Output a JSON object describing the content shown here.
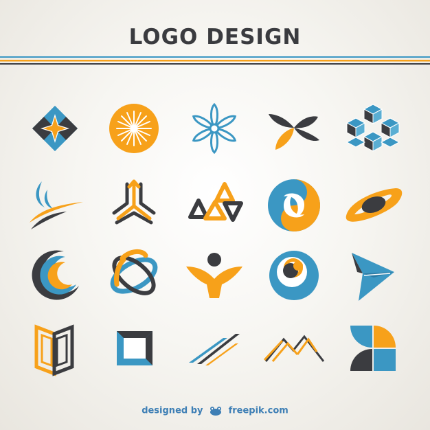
{
  "header": {
    "title": "LOGO DESIGN"
  },
  "footer": {
    "prefix": "designed by",
    "brand": "freepik.com"
  },
  "colors": {
    "orange": "#f7a11a",
    "blue": "#3b97c3",
    "dark": "#3b3c40"
  },
  "logos": [
    {
      "name": "diamond-star-logo-icon"
    },
    {
      "name": "orange-sun-starburst-logo-icon"
    },
    {
      "name": "blue-flower-outline-logo-icon"
    },
    {
      "name": "leaf-propeller-logo-icon"
    },
    {
      "name": "isometric-cubes-logo-icon"
    },
    {
      "name": "swoosh-lines-logo-icon"
    },
    {
      "name": "tri-arrow-logo-icon"
    },
    {
      "name": "linked-triangles-logo-icon"
    },
    {
      "name": "yin-yang-circle-logo-icon"
    },
    {
      "name": "planet-ring-logo-icon"
    },
    {
      "name": "crescent-rings-logo-icon"
    },
    {
      "name": "orbit-ellipses-logo-icon"
    },
    {
      "name": "person-arms-logo-icon"
    },
    {
      "name": "eye-circle-logo-icon"
    },
    {
      "name": "paper-plane-logo-icon"
    },
    {
      "name": "open-frame-logo-icon"
    },
    {
      "name": "square-frame-logo-icon"
    },
    {
      "name": "parallel-slashes-logo-icon"
    },
    {
      "name": "mountain-lines-logo-icon"
    },
    {
      "name": "quad-leaf-logo-icon"
    }
  ]
}
